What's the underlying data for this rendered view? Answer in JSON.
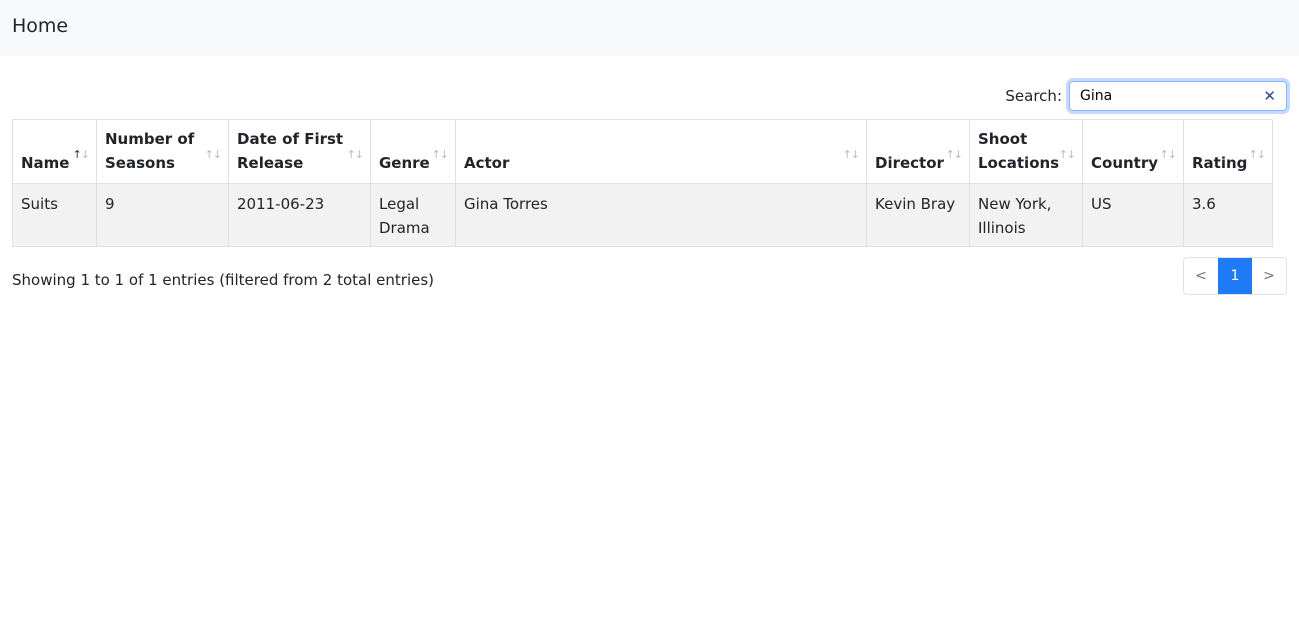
{
  "nav": {
    "title": "Home"
  },
  "search": {
    "label": "Search:",
    "value": "Gina",
    "clear_icon": "close-icon"
  },
  "table": {
    "columns": [
      "Name",
      "Number of Seasons",
      "Date of First Release",
      "Genre",
      "Actor",
      "Director",
      "Shoot Locations",
      "Country",
      "Rating"
    ],
    "sort": {
      "column": "Name",
      "direction": "ascending"
    },
    "rows": [
      [
        "Suits",
        "9",
        "2011-06-23",
        "Legal Drama",
        "Gina Torres",
        "Kevin Bray",
        "New York, Illinois",
        "US",
        "3.6"
      ]
    ]
  },
  "info": "Showing 1 to 1 of 1 entries (filtered from 2 total entries)",
  "pagination": {
    "prev": "<",
    "pages": [
      "1"
    ],
    "next": ">",
    "active": "1"
  },
  "colors": {
    "accent": "#1f7bf5"
  }
}
